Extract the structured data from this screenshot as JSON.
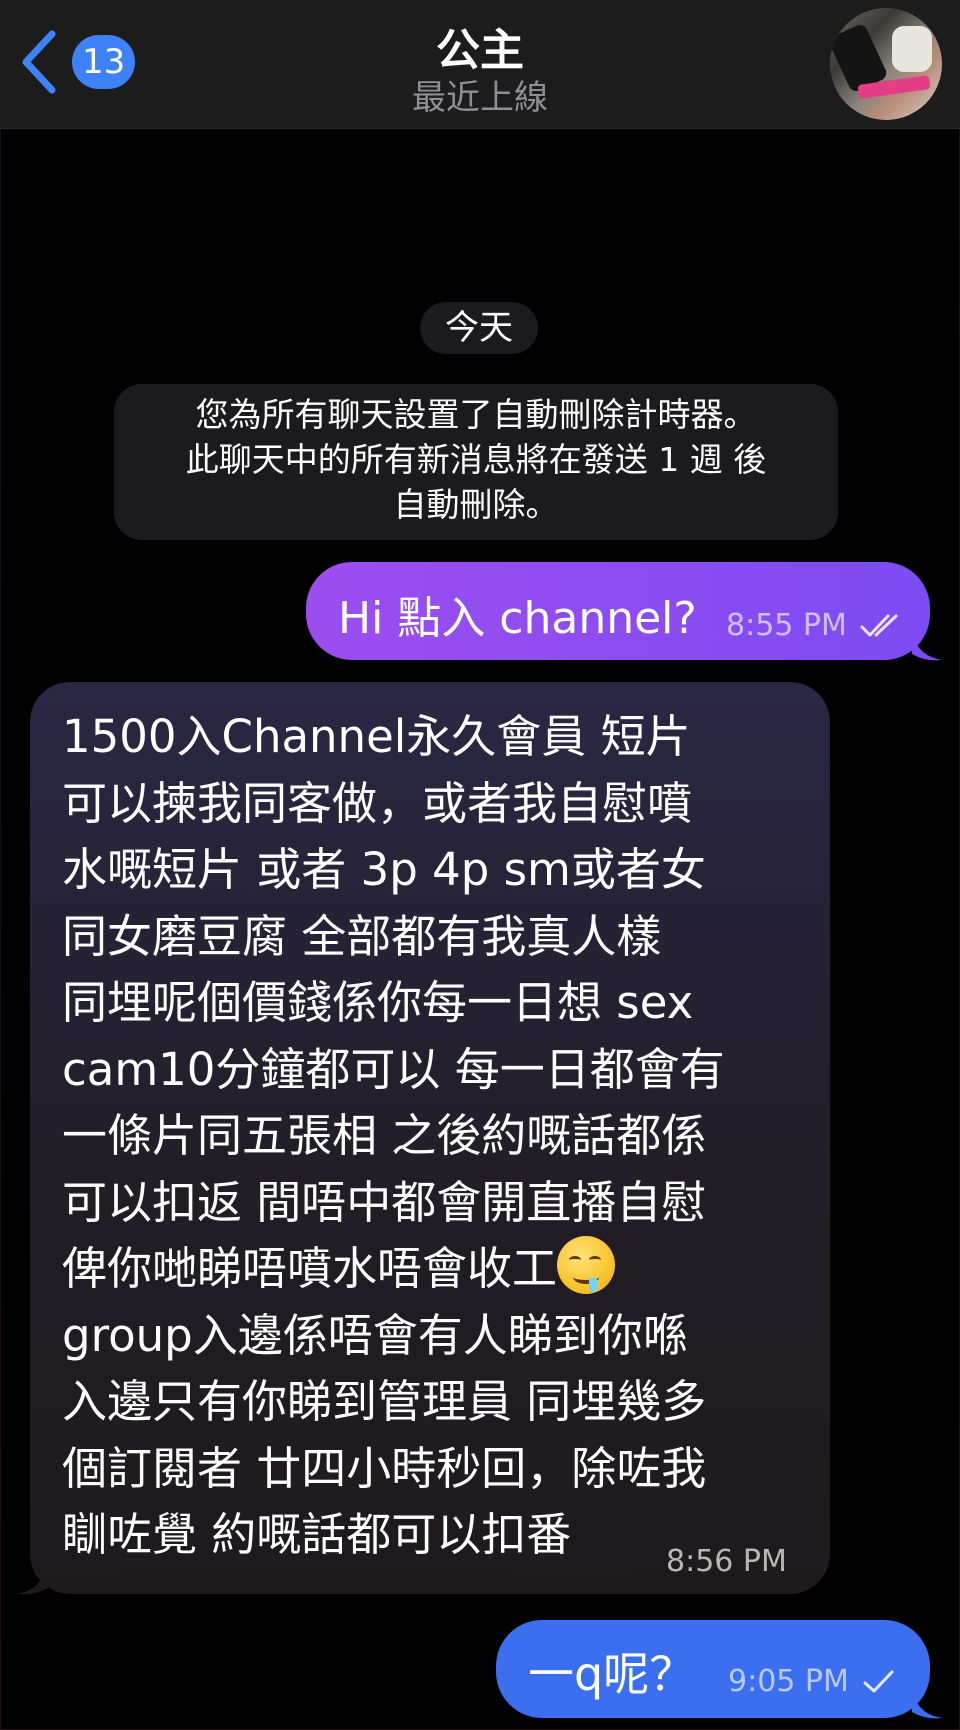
{
  "header": {
    "back_count": "13",
    "title": "公主",
    "status": "最近上線"
  },
  "colors": {
    "accent": "#3e82f7",
    "outgoing_purple": "#8a4df2",
    "outgoing_blue": "#3b6ff0",
    "incoming": "#25212f",
    "header_bg": "#1c1c1d"
  },
  "chat": {
    "date_label": "今天",
    "system_notice": [
      "您為所有聊天設置了自動刪除計時器。",
      "此聊天中的所有新消息將在發送 1 週 後",
      "自動刪除。"
    ],
    "messages": [
      {
        "direction": "out",
        "text": "Hi 點入 channel?",
        "time": "8:55 PM",
        "status": "read"
      },
      {
        "direction": "in",
        "lines": [
          "1500入Channel永久會員 短片",
          "可以揀我同客做，或者我自慰噴",
          "水嘅短片 或者 3p 4p sm或者女",
          "同女磨豆腐 全部都有我真人樣",
          "同埋呢個價錢係你每一日想 sex",
          "cam10分鐘都可以 每一日都會有",
          "一條片同五張相 之後約嘅話都係",
          "可以扣返 間唔中都會開直播自慰",
          "俾你哋睇唔噴水唔會收工",
          "group入邊係唔會有人睇到你喺",
          "入邊只有你睇到管理員 同埋幾多",
          "個訂閱者 廿四小時秒回，除咗我",
          "瞓咗覺 約嘅話都可以扣番"
        ],
        "emoji": "drooling-face",
        "time": "8:56 PM"
      },
      {
        "direction": "out",
        "text": "一q呢？",
        "time": "9:05 PM",
        "status": "sent"
      }
    ]
  }
}
